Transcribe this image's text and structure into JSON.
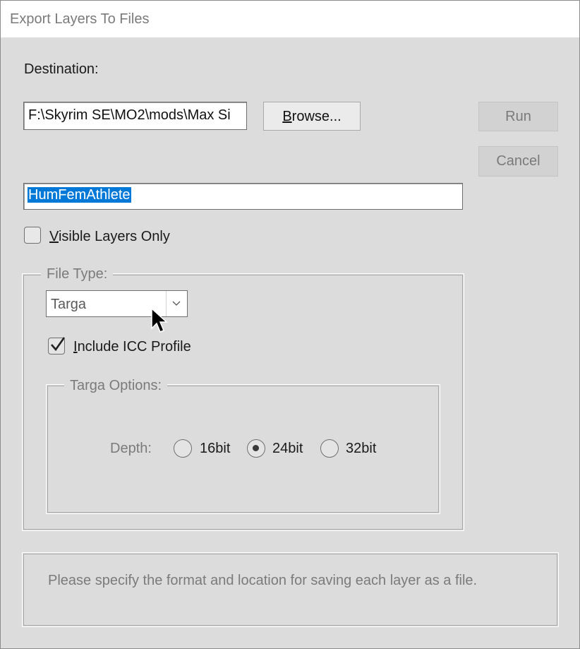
{
  "window": {
    "title": "Export Layers To Files"
  },
  "destination": {
    "label": "Destination:",
    "path_value": "F:\\Skyrim SE\\MO2\\mods\\Max Si",
    "browse_label_accel": "B",
    "browse_label_rest": "rowse..."
  },
  "actions": {
    "run_label": "Run",
    "cancel_label": "Cancel"
  },
  "prefix": {
    "value": "HumFemAthlete"
  },
  "visible_layers": {
    "label_accel": "V",
    "label_rest": "isible Layers Only",
    "checked": false
  },
  "file_type": {
    "group_label": "File Type:",
    "selected": "Targa",
    "include_icc_accel": "I",
    "include_icc_rest": "nclude ICC Profile",
    "include_icc_checked": true
  },
  "targa_options": {
    "group_label": "Targa Options:",
    "depth_label": "Depth:",
    "options": [
      "16bit",
      "24bit",
      "32bit"
    ],
    "selected": "24bit"
  },
  "status": {
    "message": "Please specify the format and location for saving each layer as a file."
  },
  "colors": {
    "selection_bg": "#0078d7",
    "selection_fg": "#ffffff",
    "dialog_bg": "#dcdcdc"
  }
}
